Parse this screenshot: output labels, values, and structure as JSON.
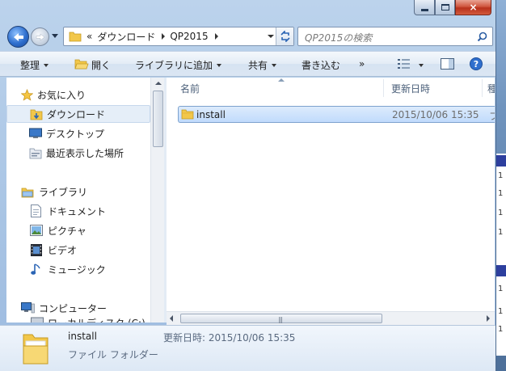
{
  "window": {
    "caption_buttons": {
      "minimize": "minimize",
      "maximize": "maximize",
      "close": "×"
    }
  },
  "address_bar": {
    "overflow": "«",
    "segments": [
      "ダウンロード",
      "QP2015"
    ],
    "search_placeholder": "QP2015の検索"
  },
  "toolbar": {
    "organize": "整理",
    "open": "開く",
    "add_to_library": "ライブラリに追加",
    "share": "共有",
    "burn": "書き込む",
    "more": "»"
  },
  "nav": {
    "favorites_header": "お気に入り",
    "favorites": [
      "ダウンロード",
      "デスクトップ",
      "最近表示した場所"
    ],
    "libraries_header": "ライブラリ",
    "libraries": [
      "ドキュメント",
      "ピクチャ",
      "ビデオ",
      "ミュージック"
    ],
    "computer_header": "コンピューター",
    "computer_partial": "ローカルディスク (C:)"
  },
  "file_list": {
    "columns": {
      "name": "名前",
      "modified": "更新日時",
      "type": "種"
    },
    "rows": [
      {
        "name": "install",
        "modified": "2015/10/06 15:35",
        "type": "フ"
      }
    ]
  },
  "details": {
    "name": "install",
    "modified_label": "更新日時:",
    "modified_value": "2015/10/06 15:35",
    "type": "ファイル フォルダー"
  },
  "colors": {
    "accent": "#3d7cd6",
    "selection_bg": "#c1dbfc",
    "selection_border": "#7da2ce",
    "folder": "#f2c74a"
  }
}
